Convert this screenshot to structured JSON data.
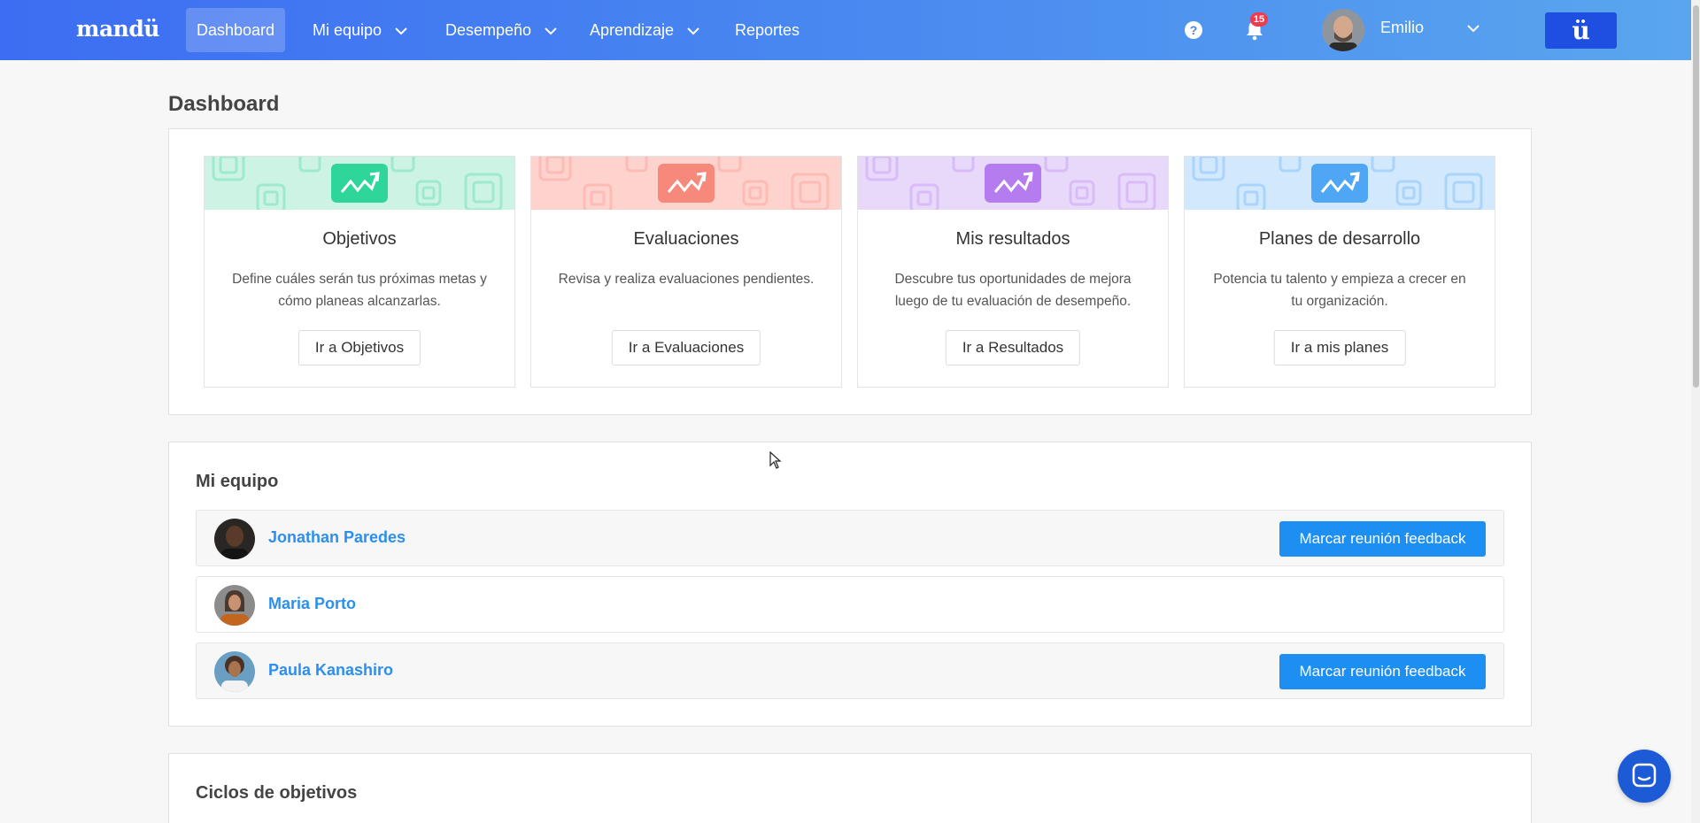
{
  "brand": {
    "logo": "mandü"
  },
  "nav": {
    "items": [
      {
        "label": "Dashboard",
        "active": true,
        "has_dropdown": false
      },
      {
        "label": "Mi equipo",
        "active": false,
        "has_dropdown": true
      },
      {
        "label": "Desempeño",
        "active": false,
        "has_dropdown": true
      },
      {
        "label": "Aprendizaje",
        "active": false,
        "has_dropdown": true
      },
      {
        "label": "Reportes",
        "active": false,
        "has_dropdown": false
      }
    ],
    "help_icon": "question-circle-icon",
    "notifications": {
      "icon": "bell-icon",
      "count": "15"
    },
    "user": {
      "name": "Emilio",
      "icon": "chevron-down-icon"
    },
    "app_button": "ü"
  },
  "page": {
    "title": "Dashboard"
  },
  "cards": [
    {
      "title": "Objetivos",
      "description": "Define cuáles serán tus próximas metas y cómo planeas alcanzarlas.",
      "button": "Ir a Objetivos",
      "color": "#2fd69a",
      "bg": "#cdf3e4"
    },
    {
      "title": "Evaluaciones",
      "description": "Revisa y realiza evaluaciones pendientes.",
      "button": "Ir a Evaluaciones",
      "color": "#f7887c",
      "bg": "#fed2cd"
    },
    {
      "title": "Mis resultados",
      "description": "Descubre tus oportunidades de mejora luego de tu evaluación de desempeño.",
      "button": "Ir a Resultados",
      "color": "#b57cf0",
      "bg": "#e8d9fb"
    },
    {
      "title": "Planes de desarrollo",
      "description": "Potencia tu talento y empieza a crecer en tu organización.",
      "button": "Ir a mis planes",
      "color": "#4ea6f4",
      "bg": "#d2e8fd"
    }
  ],
  "team": {
    "title": "Mi equipo",
    "members": [
      {
        "name": "Jonathan Paredes",
        "action": "Marcar reunión feedback",
        "has_action": true
      },
      {
        "name": "Maria Porto",
        "action": "",
        "has_action": false
      },
      {
        "name": "Paula Kanashiro",
        "action": "Marcar reunión feedback",
        "has_action": true
      }
    ]
  },
  "cycles": {
    "title": "Ciclos de objetivos"
  },
  "colors": {
    "nav_start": "#3d6df2",
    "nav_end": "#5aa6ee",
    "primary_button": "#1d8ef2",
    "link": "#2c8ff0",
    "badge": "#ef3b4d"
  }
}
